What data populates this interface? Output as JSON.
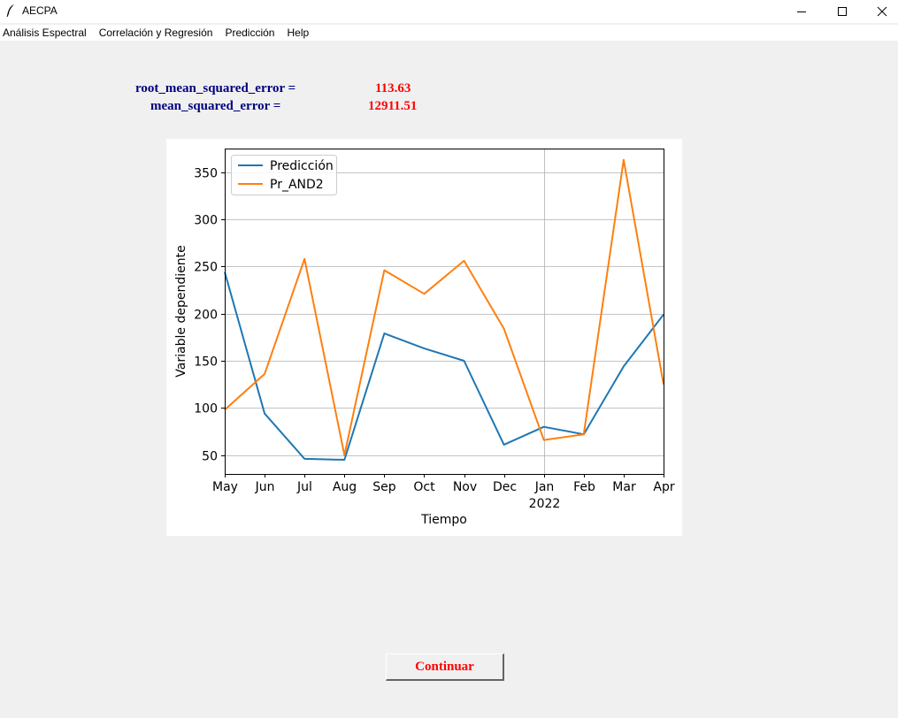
{
  "window": {
    "title": "AECPA",
    "icon": "feather-icon"
  },
  "menu": [
    {
      "label": "Análisis Espectral"
    },
    {
      "label": "Correlación y Regresión"
    },
    {
      "label": "Predicción"
    },
    {
      "label": "Help"
    }
  ],
  "metrics": [
    {
      "label": "root_mean_squared_error =",
      "value": "113.63"
    },
    {
      "label": "mean_squared_error =",
      "value": "12911.51"
    }
  ],
  "chart_data": {
    "type": "line",
    "xlabel": "Tiempo",
    "ylabel": "Variable dependiente",
    "categories": [
      "May",
      "Jun",
      "Jul",
      "Aug",
      "Sep",
      "Oct",
      "Nov",
      "Dec",
      "Jan",
      "Feb",
      "Mar",
      "Apr"
    ],
    "year_label": {
      "text": "2022",
      "under": "Jan"
    },
    "ylim": [
      30,
      375
    ],
    "yticks": [
      50,
      100,
      150,
      200,
      250,
      300,
      350
    ],
    "grid": true,
    "legend_position": "top-left",
    "series": [
      {
        "name": "Predicción",
        "color": "#1f77b4",
        "values": [
          244,
          94,
          46,
          45,
          179,
          163,
          150,
          61,
          80,
          72,
          144,
          199
        ]
      },
      {
        "name": "Pr_AND2",
        "color": "#ff7f0e",
        "values": [
          98,
          136,
          258,
          50,
          246,
          221,
          256,
          184,
          66,
          72,
          363,
          125
        ]
      }
    ]
  },
  "buttons": {
    "continue_label": "Continuar"
  }
}
